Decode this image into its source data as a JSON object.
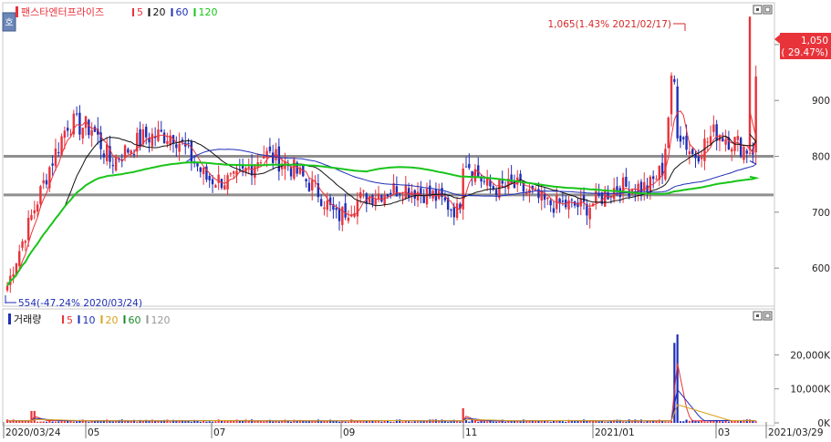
{
  "price_panel": {
    "stock_name": "팬스타엔터프라이즈",
    "legend": [
      {
        "label": "5",
        "color": "#e8333a"
      },
      {
        "label": "20",
        "color": "#111111"
      },
      {
        "label": "60",
        "color": "#1f2fb8"
      },
      {
        "label": "120",
        "color": "#19c419"
      }
    ],
    "side_tab": "호",
    "high_annotation": "1,065(1.43% 2021/02/17)",
    "low_annotation": "554(-47.24% 2020/03/24)",
    "current_price": "1,050",
    "current_change": "( 29.47%)"
  },
  "volume_panel": {
    "title": "거래량",
    "legend": [
      {
        "label": "5",
        "color": "#e8333a"
      },
      {
        "label": "10",
        "color": "#1f2fb8"
      },
      {
        "label": "20",
        "color": "#d8a21a"
      },
      {
        "label": "60",
        "color": "#1a8a2a"
      },
      {
        "label": "120",
        "color": "#999999"
      }
    ]
  },
  "colors": {
    "up": "#e8333a",
    "down": "#1f2fb8",
    "ma5": "#e8333a",
    "ma20": "#111111",
    "ma60": "#1f2fb8",
    "ma120": "#19c419",
    "support": "#8f8f8f",
    "vol20": "#d8a21a"
  },
  "chart_data": {
    "type": "candlestick",
    "price_axis": {
      "ylim": [
        535,
        1070
      ],
      "ticks": [
        600,
        700,
        800,
        900,
        1000
      ],
      "tick_labels": [
        "600",
        "700",
        "800",
        "900",
        "1,000"
      ]
    },
    "volume_axis": {
      "ylim": [
        0,
        30000
      ],
      "ticks": [
        0,
        10000,
        20000
      ],
      "tick_labels": [
        "0K",
        "10,000K",
        "20,000K"
      ]
    },
    "x_axis": {
      "labels": [
        "2020/03/24",
        "05",
        "07",
        "09",
        "11",
        "2021/01",
        "03",
        "2021/03/29"
      ]
    },
    "horizontal_lines": [
      800,
      731
    ],
    "points": [
      {
        "date": "2020/03/24",
        "close": 554
      },
      {
        "date": "2020/04/01",
        "close": 640
      },
      {
        "date": "2020/04/15",
        "close": 780
      },
      {
        "date": "2020/04/24",
        "close": 860
      },
      {
        "date": "2020/05/06",
        "close": 850
      },
      {
        "date": "2020/05/15",
        "close": 790
      },
      {
        "date": "2020/06/01",
        "close": 835
      },
      {
        "date": "2020/06/15",
        "close": 840
      },
      {
        "date": "2020/07/01",
        "close": 760
      },
      {
        "date": "2020/07/15",
        "close": 755
      },
      {
        "date": "2020/07/29",
        "close": 805
      },
      {
        "date": "2020/08/10",
        "close": 785
      },
      {
        "date": "2020/08/24",
        "close": 740
      },
      {
        "date": "2020/09/03",
        "close": 690
      },
      {
        "date": "2020/09/15",
        "close": 725
      },
      {
        "date": "2020/10/05",
        "close": 745
      },
      {
        "date": "2020/10/20",
        "close": 730
      },
      {
        "date": "2020/11/02",
        "close": 700
      },
      {
        "date": "2020/11/04",
        "close": 800
      },
      {
        "date": "2020/11/16",
        "close": 745
      },
      {
        "date": "2020/12/01",
        "close": 745
      },
      {
        "date": "2020/12/15",
        "close": 715
      },
      {
        "date": "2021/01/04",
        "close": 710
      },
      {
        "date": "2021/01/18",
        "close": 745
      },
      {
        "date": "2021/02/03",
        "close": 745
      },
      {
        "date": "2021/02/10",
        "close": 780
      },
      {
        "date": "2021/02/15",
        "close": 960
      },
      {
        "date": "2021/02/17",
        "close": 850
      },
      {
        "date": "2021/02/25",
        "close": 800
      },
      {
        "date": "2021/03/08",
        "close": 845
      },
      {
        "date": "2021/03/22",
        "close": 815
      },
      {
        "date": "2021/03/26",
        "close": 811
      },
      {
        "date": "2021/03/29",
        "close": 1050
      }
    ],
    "volume_spikes": [
      {
        "date": "2020/04/07",
        "volume": 3500
      },
      {
        "date": "2020/11/04",
        "volume": 4300
      },
      {
        "date": "2021/02/15",
        "volume": 23500
      },
      {
        "date": "2021/02/17",
        "volume": 26000
      },
      {
        "date": "2021/03/29",
        "volume": 17500
      }
    ]
  }
}
